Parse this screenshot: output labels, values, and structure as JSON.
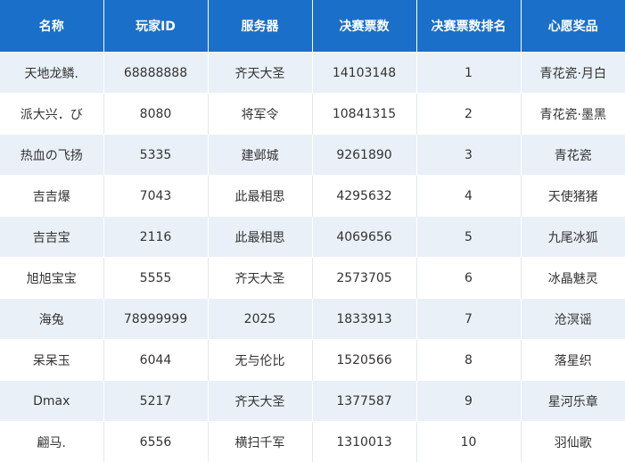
{
  "table": {
    "headers": [
      "名称",
      "玩家ID",
      "服务器",
      "决赛票数",
      "决赛票数排名",
      "心愿奖品"
    ],
    "rows": [
      [
        "天地龙鳞.",
        "68888888",
        "齐天大圣",
        "14103148",
        "1",
        "青花瓷·月白"
      ],
      [
        "派大兴．び",
        "8080",
        "将军令",
        "10841315",
        "2",
        "青花瓷·墨黑"
      ],
      [
        "热血の飞扬",
        "5335",
        "建邺城",
        "9261890",
        "3",
        "青花瓷"
      ],
      [
        "吉吉爆",
        "7043",
        "此最相思",
        "4295632",
        "4",
        "天使猪猪"
      ],
      [
        "吉吉宝",
        "2116",
        "此最相思",
        "4069656",
        "5",
        "九尾冰狐"
      ],
      [
        "旭旭宝宝",
        "5555",
        "齐天大圣",
        "2573705",
        "6",
        "冰晶魅灵"
      ],
      [
        "海兔",
        "78999999",
        "2025",
        "1833913",
        "7",
        "沧溟谣"
      ],
      [
        "呆呆玉",
        "6044",
        "无与伦比",
        "1520566",
        "8",
        "落星织"
      ],
      [
        "Dmax",
        "5217",
        "齐天大圣",
        "1377587",
        "9",
        "星河乐章"
      ],
      [
        "翩马.",
        "6556",
        "横扫千军",
        "1310013",
        "10",
        "羽仙歌"
      ]
    ]
  },
  "colors": {
    "header_bg": "#1a6fc9",
    "header_text": "#ffffff",
    "row_alt_bg": "#e9f0f8",
    "cell_text": "#333333"
  }
}
